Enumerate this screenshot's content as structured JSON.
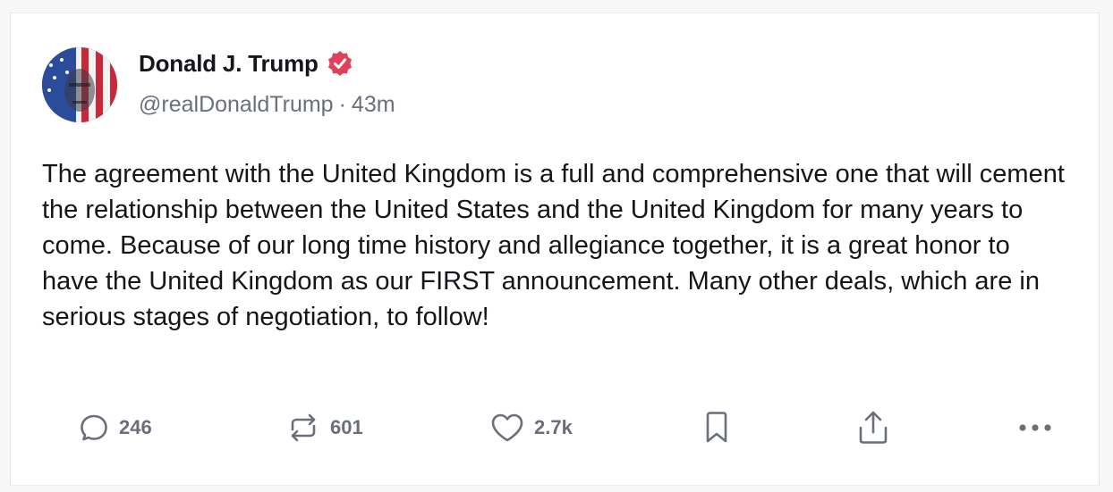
{
  "author": {
    "name": "Donald J. Trump",
    "handle": "@realDonaldTrump",
    "separator": "·",
    "time": "43m",
    "verified_color": "#e0425a"
  },
  "post": {
    "text": "The agreement with the United Kingdom is a full and comprehensive one that will cement the relationship between the United States and the United Kingdom for many years to come. Because of our long time history and allegiance together, it is a great honor to have the United Kingdom as our FIRST announcement. Many other deals, which are in serious stages of negotiation, to follow!"
  },
  "actions": {
    "reply": {
      "icon": "reply-icon",
      "count": "246"
    },
    "repost": {
      "icon": "repost-icon",
      "count": "601"
    },
    "like": {
      "icon": "heart-icon",
      "count": "2.7k"
    },
    "bookmark": {
      "icon": "bookmark-icon"
    },
    "share": {
      "icon": "share-icon"
    },
    "more": {
      "icon": "more-icon"
    }
  },
  "colors": {
    "text": "#15161a",
    "muted": "#6b6f7a",
    "background": "#f7f7f8",
    "card": "#ffffff"
  }
}
